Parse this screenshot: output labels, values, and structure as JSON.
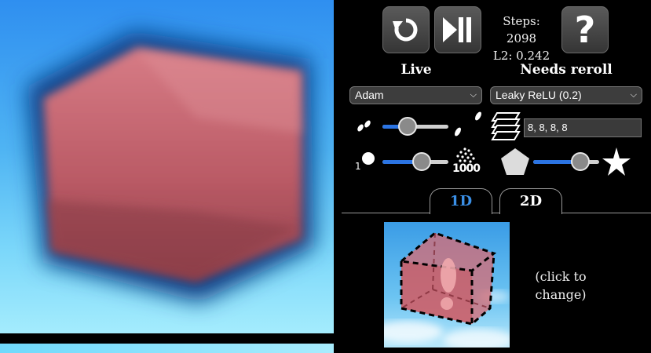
{
  "toolbar": {
    "reset_icon": "reset-icon",
    "playpause_icon": "play-pause-icon",
    "help_icon": "help-icon",
    "help_glyph": "?"
  },
  "stats": {
    "steps": "Steps: 2098",
    "l2": "L2: 0.242"
  },
  "headers": {
    "live": "Live",
    "needs_reroll": "Needs reroll"
  },
  "optimizer": {
    "selected": "Adam"
  },
  "activation": {
    "selected": "Leaky ReLU (0.2)"
  },
  "learning_rate": {
    "level": 0.38
  },
  "batch_size": {
    "level": 0.6,
    "max_label": "1000",
    "min_label": "1"
  },
  "shape_complexity": {
    "level": 0.72
  },
  "layers": {
    "value": "8, 8, 8, 8"
  },
  "tabs": {
    "one_d": "1D",
    "two_d": "2D",
    "active": "2D"
  },
  "target": {
    "hint": "(click to change)"
  },
  "colors": {
    "accent": "#2b74e3",
    "tab_active": "#3a8fe6",
    "cube": "#c0656f",
    "sky": "#4fb4f3"
  }
}
